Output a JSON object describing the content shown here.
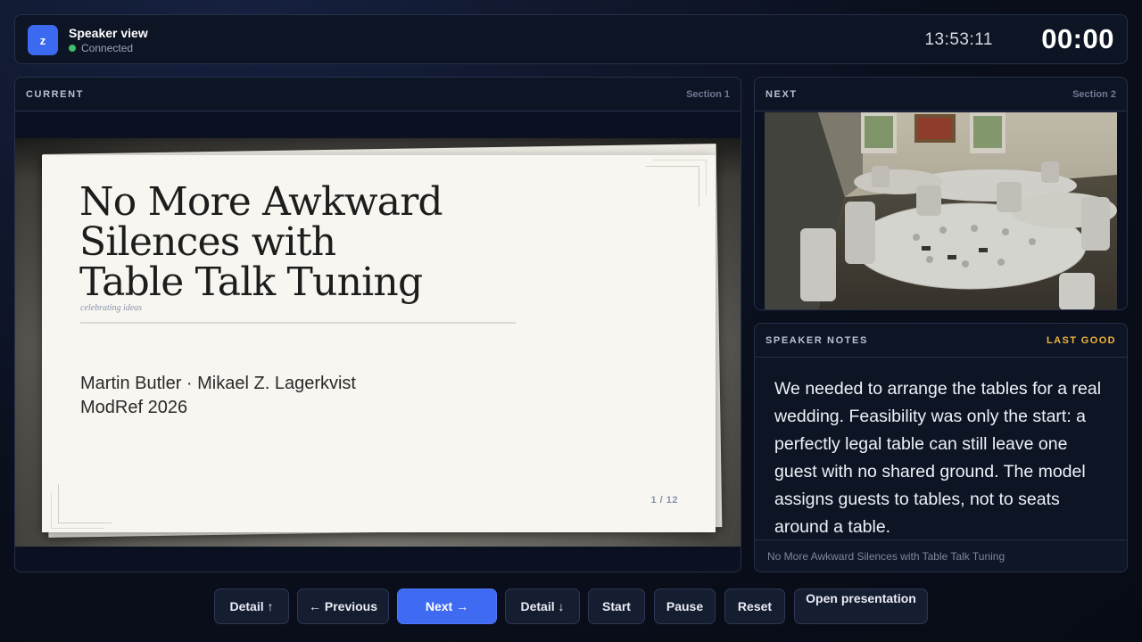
{
  "header": {
    "logo_letter": "z",
    "title": "Speaker view",
    "status": "Connected",
    "clock": "13:53:11",
    "timer": "00:00"
  },
  "current": {
    "label": "CURRENT",
    "section": "Section 1",
    "slide": {
      "title": "No More Awkward\nSilences with\nTable Talk Tuning",
      "tagline": "celebrating ideas",
      "authors": "Martin Butler · Mikael Z. Lagerkvist",
      "venue": "ModRef 2026",
      "page": "1 / 12"
    }
  },
  "next": {
    "label": "NEXT",
    "section": "Section 2"
  },
  "notes": {
    "label": "SPEAKER NOTES",
    "status": "LAST GOOD",
    "text": "We needed to arrange the tables for a real wedding. Feasibility was only the start: a perfectly legal table can still leave one guest with no shared ground. The model assigns guests to tables, not to seats around a table.",
    "footer": "No More Awkward Silences with Table Talk Tuning"
  },
  "controls": {
    "detail_up": "Detail ↑",
    "previous": "← Previous",
    "next": "Next →",
    "detail_down": "Detail ↓",
    "start": "Start",
    "pause": "Pause",
    "reset": "Reset",
    "open": "Open presentation"
  },
  "colors": {
    "accent": "#3f6bf2",
    "status_ok": "#3fbf6a",
    "warn": "#f0b43c",
    "background": "#0a0f1c"
  }
}
